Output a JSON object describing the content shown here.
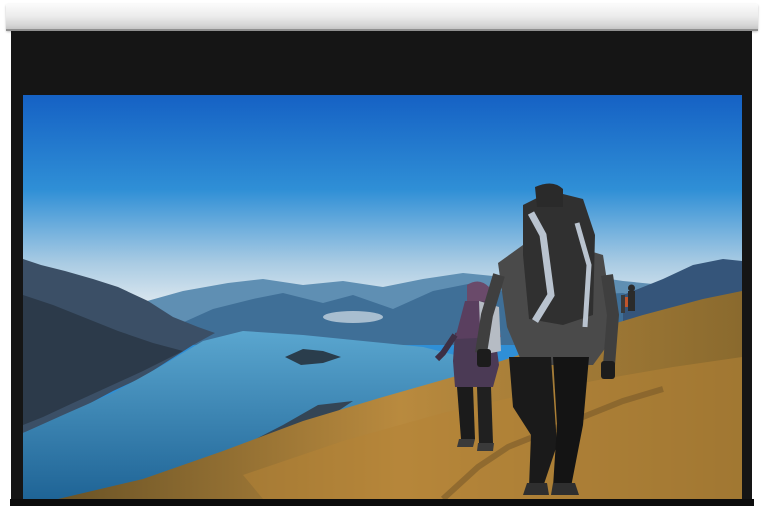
{
  "image": {
    "description_free": true,
    "colors": {
      "sky_top": "#1561c4",
      "sky_mid": "#2f8fd6",
      "horizon": "#dde8ef",
      "lake": "#2e7fb4",
      "grass": "#a47a34",
      "frame": "#151515"
    }
  }
}
